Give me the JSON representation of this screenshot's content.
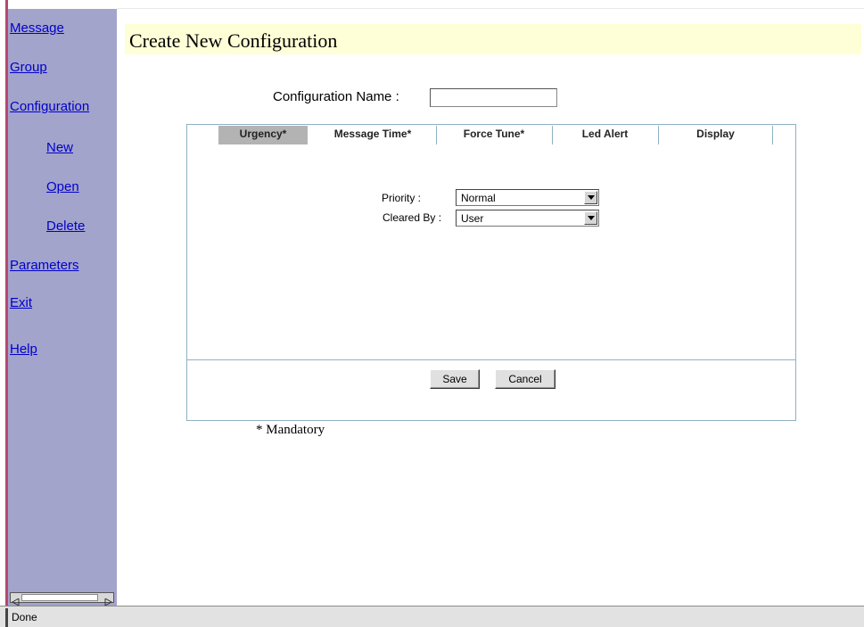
{
  "sidebar": {
    "items": [
      {
        "label": "Message"
      },
      {
        "label": "Group"
      },
      {
        "label": "Configuration"
      },
      {
        "label": "New"
      },
      {
        "label": "Open"
      },
      {
        "label": "Delete"
      },
      {
        "label": "Parameters"
      },
      {
        "label": "Exit"
      },
      {
        "label": "Help"
      }
    ]
  },
  "page": {
    "title": "Create New Configuration",
    "config_name_label": "Configuration Name :",
    "config_name_value": "",
    "mandatory_note": "* Mandatory"
  },
  "tabs": [
    {
      "label": "Urgency*",
      "active": true
    },
    {
      "label": "Message Time*",
      "active": false
    },
    {
      "label": "Force Tune*",
      "active": false
    },
    {
      "label": "Led Alert",
      "active": false
    },
    {
      "label": "Display",
      "active": false
    }
  ],
  "urgency": {
    "priority_label": "Priority :",
    "priority_value": "Normal",
    "cleared_by_label": "Cleared By :",
    "cleared_by_value": "User"
  },
  "buttons": {
    "save": "Save",
    "cancel": "Cancel"
  },
  "statusbar": {
    "text": "Done"
  },
  "colors": {
    "sidebar_bg": "#a3a4cb",
    "title_band": "#ffffd7",
    "link": "#0000cc",
    "panel_border": "#8fb1c2",
    "active_tab": "#b3b3b3"
  },
  "icons": {
    "dropdown": "triangle-down-icon",
    "scroll_left": "arrow-left-icon",
    "scroll_right": "arrow-right-icon"
  }
}
